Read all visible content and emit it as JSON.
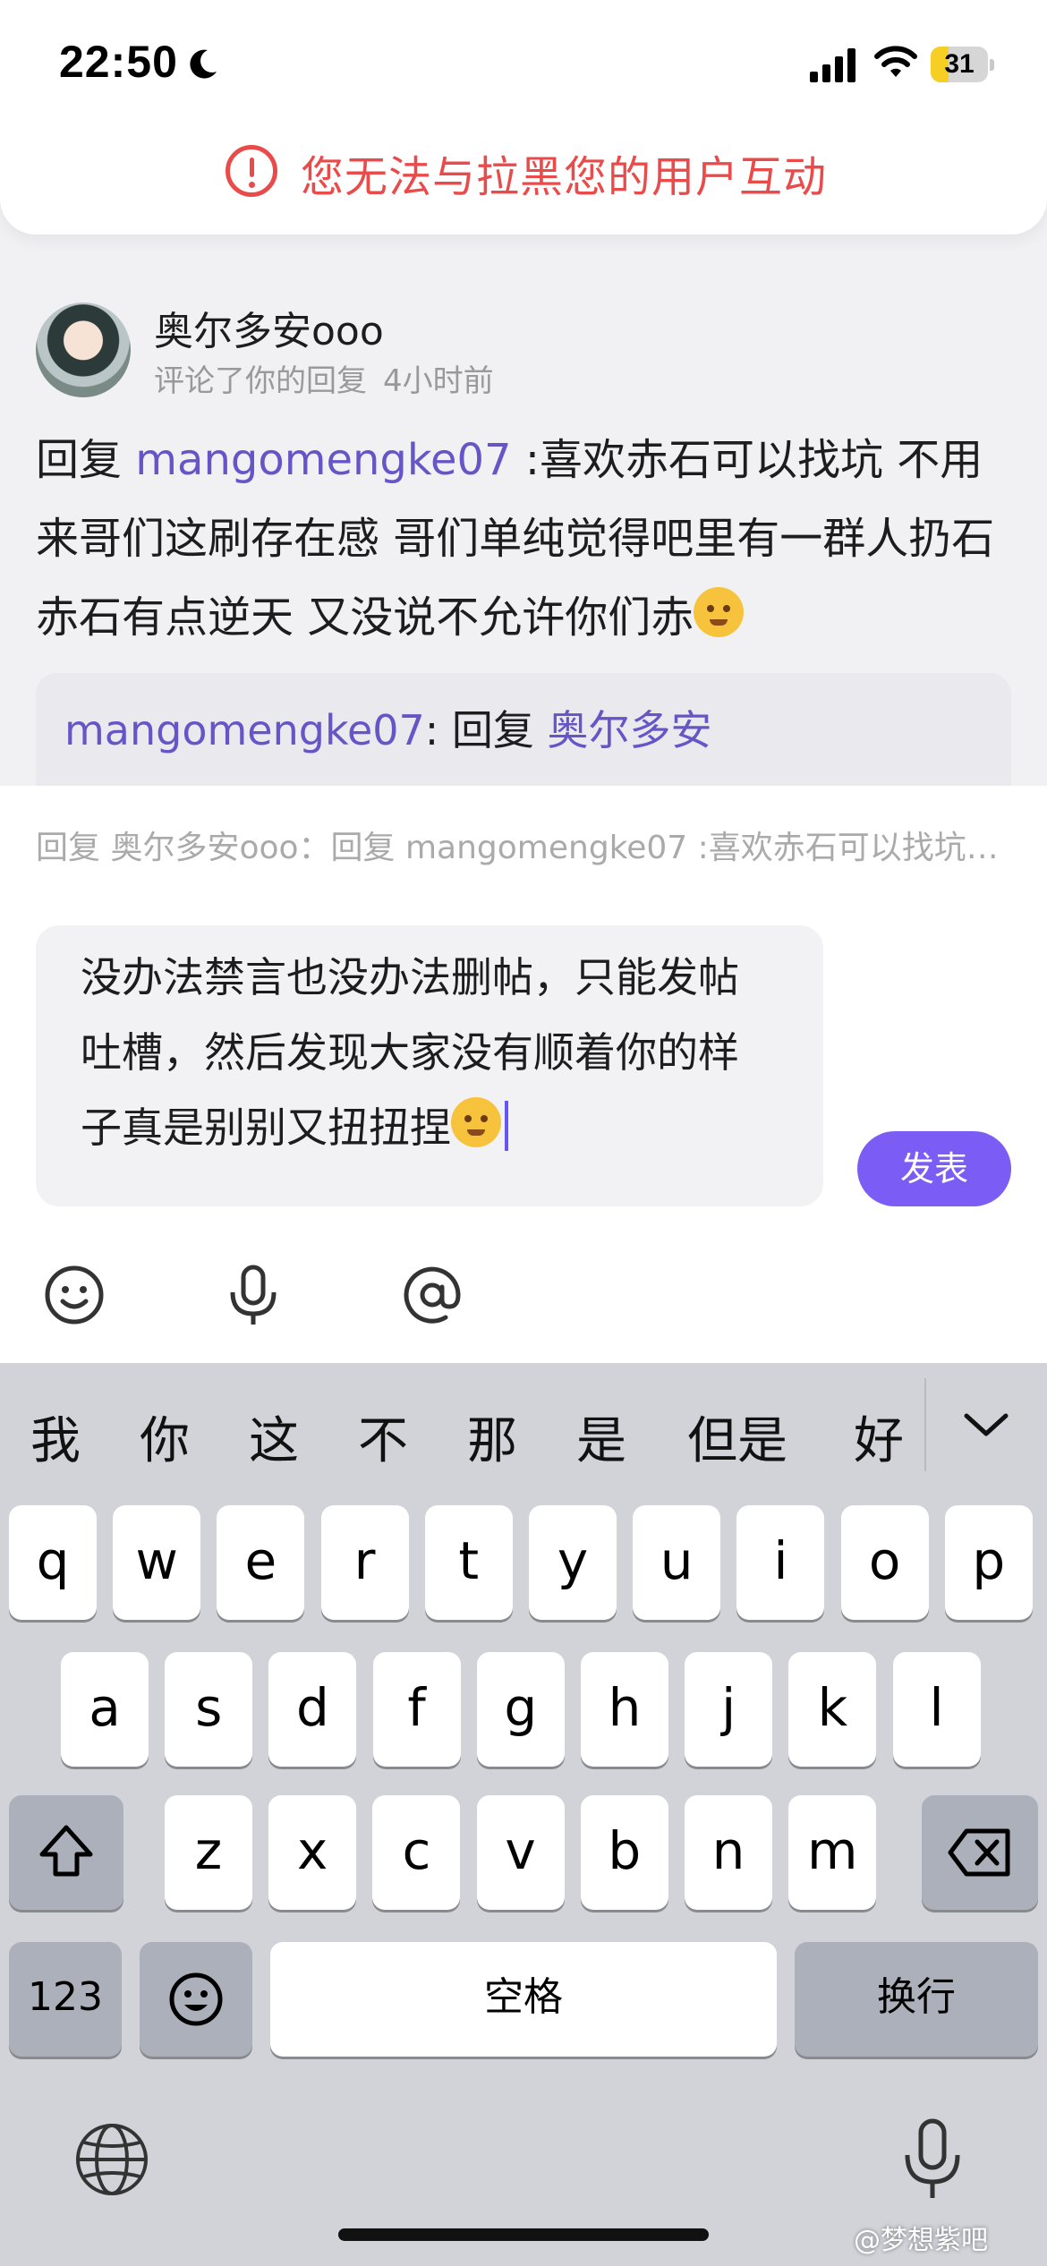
{
  "status_bar": {
    "time": "22:50",
    "battery": "31",
    "battery_level": 0.31
  },
  "banner": {
    "text": "您无法与拉黑您的用户互动",
    "color": "#e94b4b"
  },
  "notification": {
    "username": "奥尔多安ooo",
    "action": "评论了你的回复",
    "time": "4小时前",
    "reply_prefix": "回复 ",
    "mention": "mangomengke07",
    "body": " :喜欢赤石可以找坑 不用来哥们这刷存在感 哥们单纯觉得吧里有一群人扔石赤石有点逆天 又没说不允许你们赤"
  },
  "quote": {
    "author": "mangomengke07",
    "sep": ": 回复 ",
    "target": "奥尔多安"
  },
  "composer": {
    "reply_hint": "回复 奥尔多安ooo：回复  mangomengke07 :喜欢赤石可以找坑 不用来哥们这刷存在感",
    "text": "没办法禁言也没办法删帖，只能发帖吐槽，然后发现大家没有顺着你的样子真是别别又扭扭捏",
    "send_label": "发表",
    "accent": "#7b5cf5"
  },
  "toolbar": {
    "icons": [
      "smiley-icon",
      "microphone-icon",
      "at-icon"
    ]
  },
  "keyboard": {
    "candidates": [
      "我",
      "你",
      "这",
      "不",
      "那",
      "是",
      "但是",
      "好"
    ],
    "row1": [
      "q",
      "w",
      "e",
      "r",
      "t",
      "y",
      "u",
      "i",
      "o",
      "p"
    ],
    "row2": [
      "a",
      "s",
      "d",
      "f",
      "g",
      "h",
      "j",
      "k",
      "l"
    ],
    "row3": [
      "z",
      "x",
      "c",
      "v",
      "b",
      "n",
      "m"
    ],
    "numbers_label": "123",
    "space_label": "空格",
    "return_label": "换行"
  },
  "watermark": "@梦想紫吧"
}
